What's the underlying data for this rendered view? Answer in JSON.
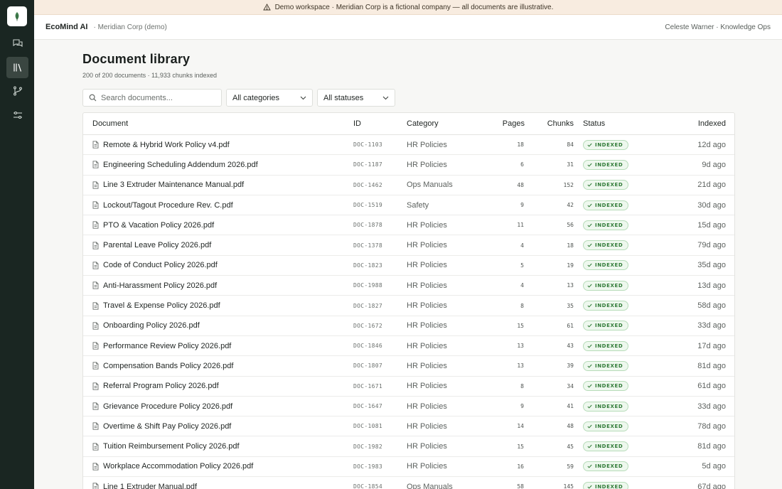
{
  "banner": {
    "text": "Demo workspace · Meridian Corp is a fictional company — all documents are illustrative.",
    "icon": "warning-triangle-icon"
  },
  "topbar": {
    "brand": "EcoMind AI",
    "org": "· Meridian Corp (demo)",
    "user": "Celeste Warner · Knowledge Ops"
  },
  "rail": {
    "items": [
      {
        "name": "chat-icon",
        "active": false
      },
      {
        "name": "library-icon",
        "active": true
      },
      {
        "name": "branch-icon",
        "active": false
      },
      {
        "name": "sliders-icon",
        "active": false
      }
    ]
  },
  "page": {
    "title": "Document library",
    "subtitle": "200 of 200 documents · 11,933 chunks indexed"
  },
  "filters": {
    "search_placeholder": "Search documents...",
    "category": "All categories",
    "status": "All statuses"
  },
  "table": {
    "headers": {
      "document": "Document",
      "id": "ID",
      "category": "Category",
      "pages": "Pages",
      "chunks": "Chunks",
      "status": "Status",
      "indexed": "Indexed"
    },
    "rows": [
      {
        "name": "Remote & Hybrid Work Policy v4.pdf",
        "id": "DOC-1103",
        "category": "HR Policies",
        "pages": "18",
        "chunks": "84",
        "status": "INDEXED",
        "indexed": "12d ago"
      },
      {
        "name": "Engineering Scheduling Addendum 2026.pdf",
        "id": "DOC-1187",
        "category": "HR Policies",
        "pages": "6",
        "chunks": "31",
        "status": "INDEXED",
        "indexed": "9d ago"
      },
      {
        "name": "Line 3 Extruder Maintenance Manual.pdf",
        "id": "DOC-1462",
        "category": "Ops Manuals",
        "pages": "48",
        "chunks": "152",
        "status": "INDEXED",
        "indexed": "21d ago"
      },
      {
        "name": "Lockout/Tagout Procedure Rev. C.pdf",
        "id": "DOC-1519",
        "category": "Safety",
        "pages": "9",
        "chunks": "42",
        "status": "INDEXED",
        "indexed": "30d ago"
      },
      {
        "name": "PTO & Vacation Policy 2026.pdf",
        "id": "DOC-1878",
        "category": "HR Policies",
        "pages": "11",
        "chunks": "56",
        "status": "INDEXED",
        "indexed": "15d ago"
      },
      {
        "name": "Parental Leave Policy 2026.pdf",
        "id": "DOC-1378",
        "category": "HR Policies",
        "pages": "4",
        "chunks": "18",
        "status": "INDEXED",
        "indexed": "79d ago"
      },
      {
        "name": "Code of Conduct Policy 2026.pdf",
        "id": "DOC-1823",
        "category": "HR Policies",
        "pages": "5",
        "chunks": "19",
        "status": "INDEXED",
        "indexed": "35d ago"
      },
      {
        "name": "Anti-Harassment Policy 2026.pdf",
        "id": "DOC-1988",
        "category": "HR Policies",
        "pages": "4",
        "chunks": "13",
        "status": "INDEXED",
        "indexed": "13d ago"
      },
      {
        "name": "Travel & Expense Policy 2026.pdf",
        "id": "DOC-1827",
        "category": "HR Policies",
        "pages": "8",
        "chunks": "35",
        "status": "INDEXED",
        "indexed": "58d ago"
      },
      {
        "name": "Onboarding Policy 2026.pdf",
        "id": "DOC-1672",
        "category": "HR Policies",
        "pages": "15",
        "chunks": "61",
        "status": "INDEXED",
        "indexed": "33d ago"
      },
      {
        "name": "Performance Review Policy 2026.pdf",
        "id": "DOC-1846",
        "category": "HR Policies",
        "pages": "13",
        "chunks": "43",
        "status": "INDEXED",
        "indexed": "17d ago"
      },
      {
        "name": "Compensation Bands Policy 2026.pdf",
        "id": "DOC-1807",
        "category": "HR Policies",
        "pages": "13",
        "chunks": "39",
        "status": "INDEXED",
        "indexed": "81d ago"
      },
      {
        "name": "Referral Program Policy 2026.pdf",
        "id": "DOC-1671",
        "category": "HR Policies",
        "pages": "8",
        "chunks": "34",
        "status": "INDEXED",
        "indexed": "61d ago"
      },
      {
        "name": "Grievance Procedure Policy 2026.pdf",
        "id": "DOC-1647",
        "category": "HR Policies",
        "pages": "9",
        "chunks": "41",
        "status": "INDEXED",
        "indexed": "33d ago"
      },
      {
        "name": "Overtime & Shift Pay Policy 2026.pdf",
        "id": "DOC-1081",
        "category": "HR Policies",
        "pages": "14",
        "chunks": "48",
        "status": "INDEXED",
        "indexed": "78d ago"
      },
      {
        "name": "Tuition Reimbursement Policy 2026.pdf",
        "id": "DOC-1982",
        "category": "HR Policies",
        "pages": "15",
        "chunks": "45",
        "status": "INDEXED",
        "indexed": "81d ago"
      },
      {
        "name": "Workplace Accommodation Policy 2026.pdf",
        "id": "DOC-1983",
        "category": "HR Policies",
        "pages": "16",
        "chunks": "59",
        "status": "INDEXED",
        "indexed": "5d ago"
      },
      {
        "name": "Line 1 Extruder Manual.pdf",
        "id": "DOC-1854",
        "category": "Ops Manuals",
        "pages": "58",
        "chunks": "145",
        "status": "INDEXED",
        "indexed": "67d ago"
      }
    ]
  },
  "colors": {
    "rail": "#1a2622",
    "banner": "#f8ece0",
    "badge_green": "#2f7a36",
    "logo_leaf": "#3f7d4c"
  }
}
